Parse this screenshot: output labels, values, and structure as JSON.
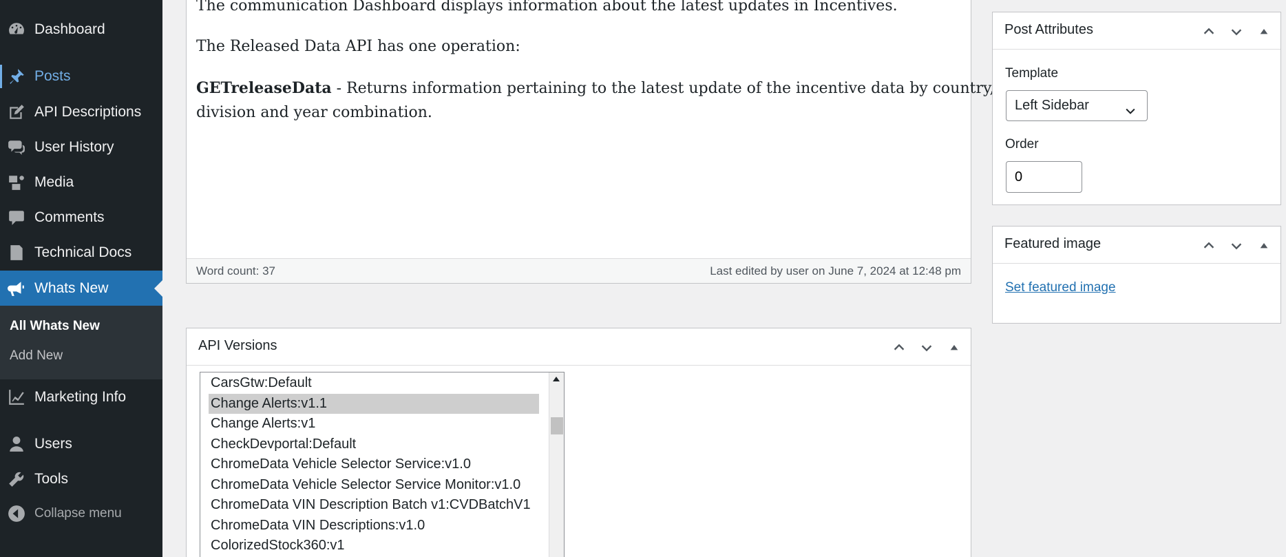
{
  "sidebar": {
    "items": [
      {
        "label": "Dashboard",
        "icon": "dashboard-icon"
      },
      {
        "label": "Posts",
        "icon": "pushpin-icon"
      },
      {
        "label": "API Descriptions",
        "icon": "edit-icon"
      },
      {
        "label": "User History",
        "icon": "chat-bubbles-icon"
      },
      {
        "label": "Media",
        "icon": "media-icon"
      },
      {
        "label": "Comments",
        "icon": "comment-icon"
      },
      {
        "label": "Technical Docs",
        "icon": "document-icon"
      },
      {
        "label": "Whats New",
        "icon": "megaphone-icon"
      },
      {
        "label": "Marketing Info",
        "icon": "chart-line-icon"
      },
      {
        "label": "Users",
        "icon": "user-icon"
      },
      {
        "label": "Tools",
        "icon": "wrench-icon"
      }
    ],
    "submenu": [
      "All Whats New",
      "Add New"
    ],
    "collapse_label": "Collapse menu",
    "accent_color": "#2271b1"
  },
  "editor": {
    "paragraph1": "The communication Dashboard displays information about the latest updates in Incentives.",
    "paragraph2": "The Released Data API has one operation:",
    "op_name": "GETreleaseData",
    "op_desc_line1": " - Returns information pertaining to the latest update of the incentive data by country,",
    "op_desc_line2": "division and year combination.",
    "word_count": "Word count: 37",
    "last_edited": "Last edited by user on June 7, 2024 at 12:48 pm"
  },
  "api_versions": {
    "title": "API Versions",
    "options": [
      "CarsGtw:Default",
      "Change Alerts:v1.1",
      "Change Alerts:v1",
      "CheckDevportal:Default",
      "ChromeData Vehicle Selector Service:v1.0",
      "ChromeData Vehicle Selector Service Monitor:v1.0",
      "ChromeData VIN Description Batch v1:CVDBatchV1",
      "ChromeData VIN Descriptions:v1.0",
      "ColorizedStock360:v1"
    ],
    "selected": "Change Alerts:v1.1"
  },
  "post_attributes": {
    "title": "Post Attributes",
    "template_label": "Template",
    "template_value": "Left Sidebar",
    "order_label": "Order",
    "order_value": "0"
  },
  "featured_image": {
    "title": "Featured image",
    "link": "Set featured image"
  }
}
